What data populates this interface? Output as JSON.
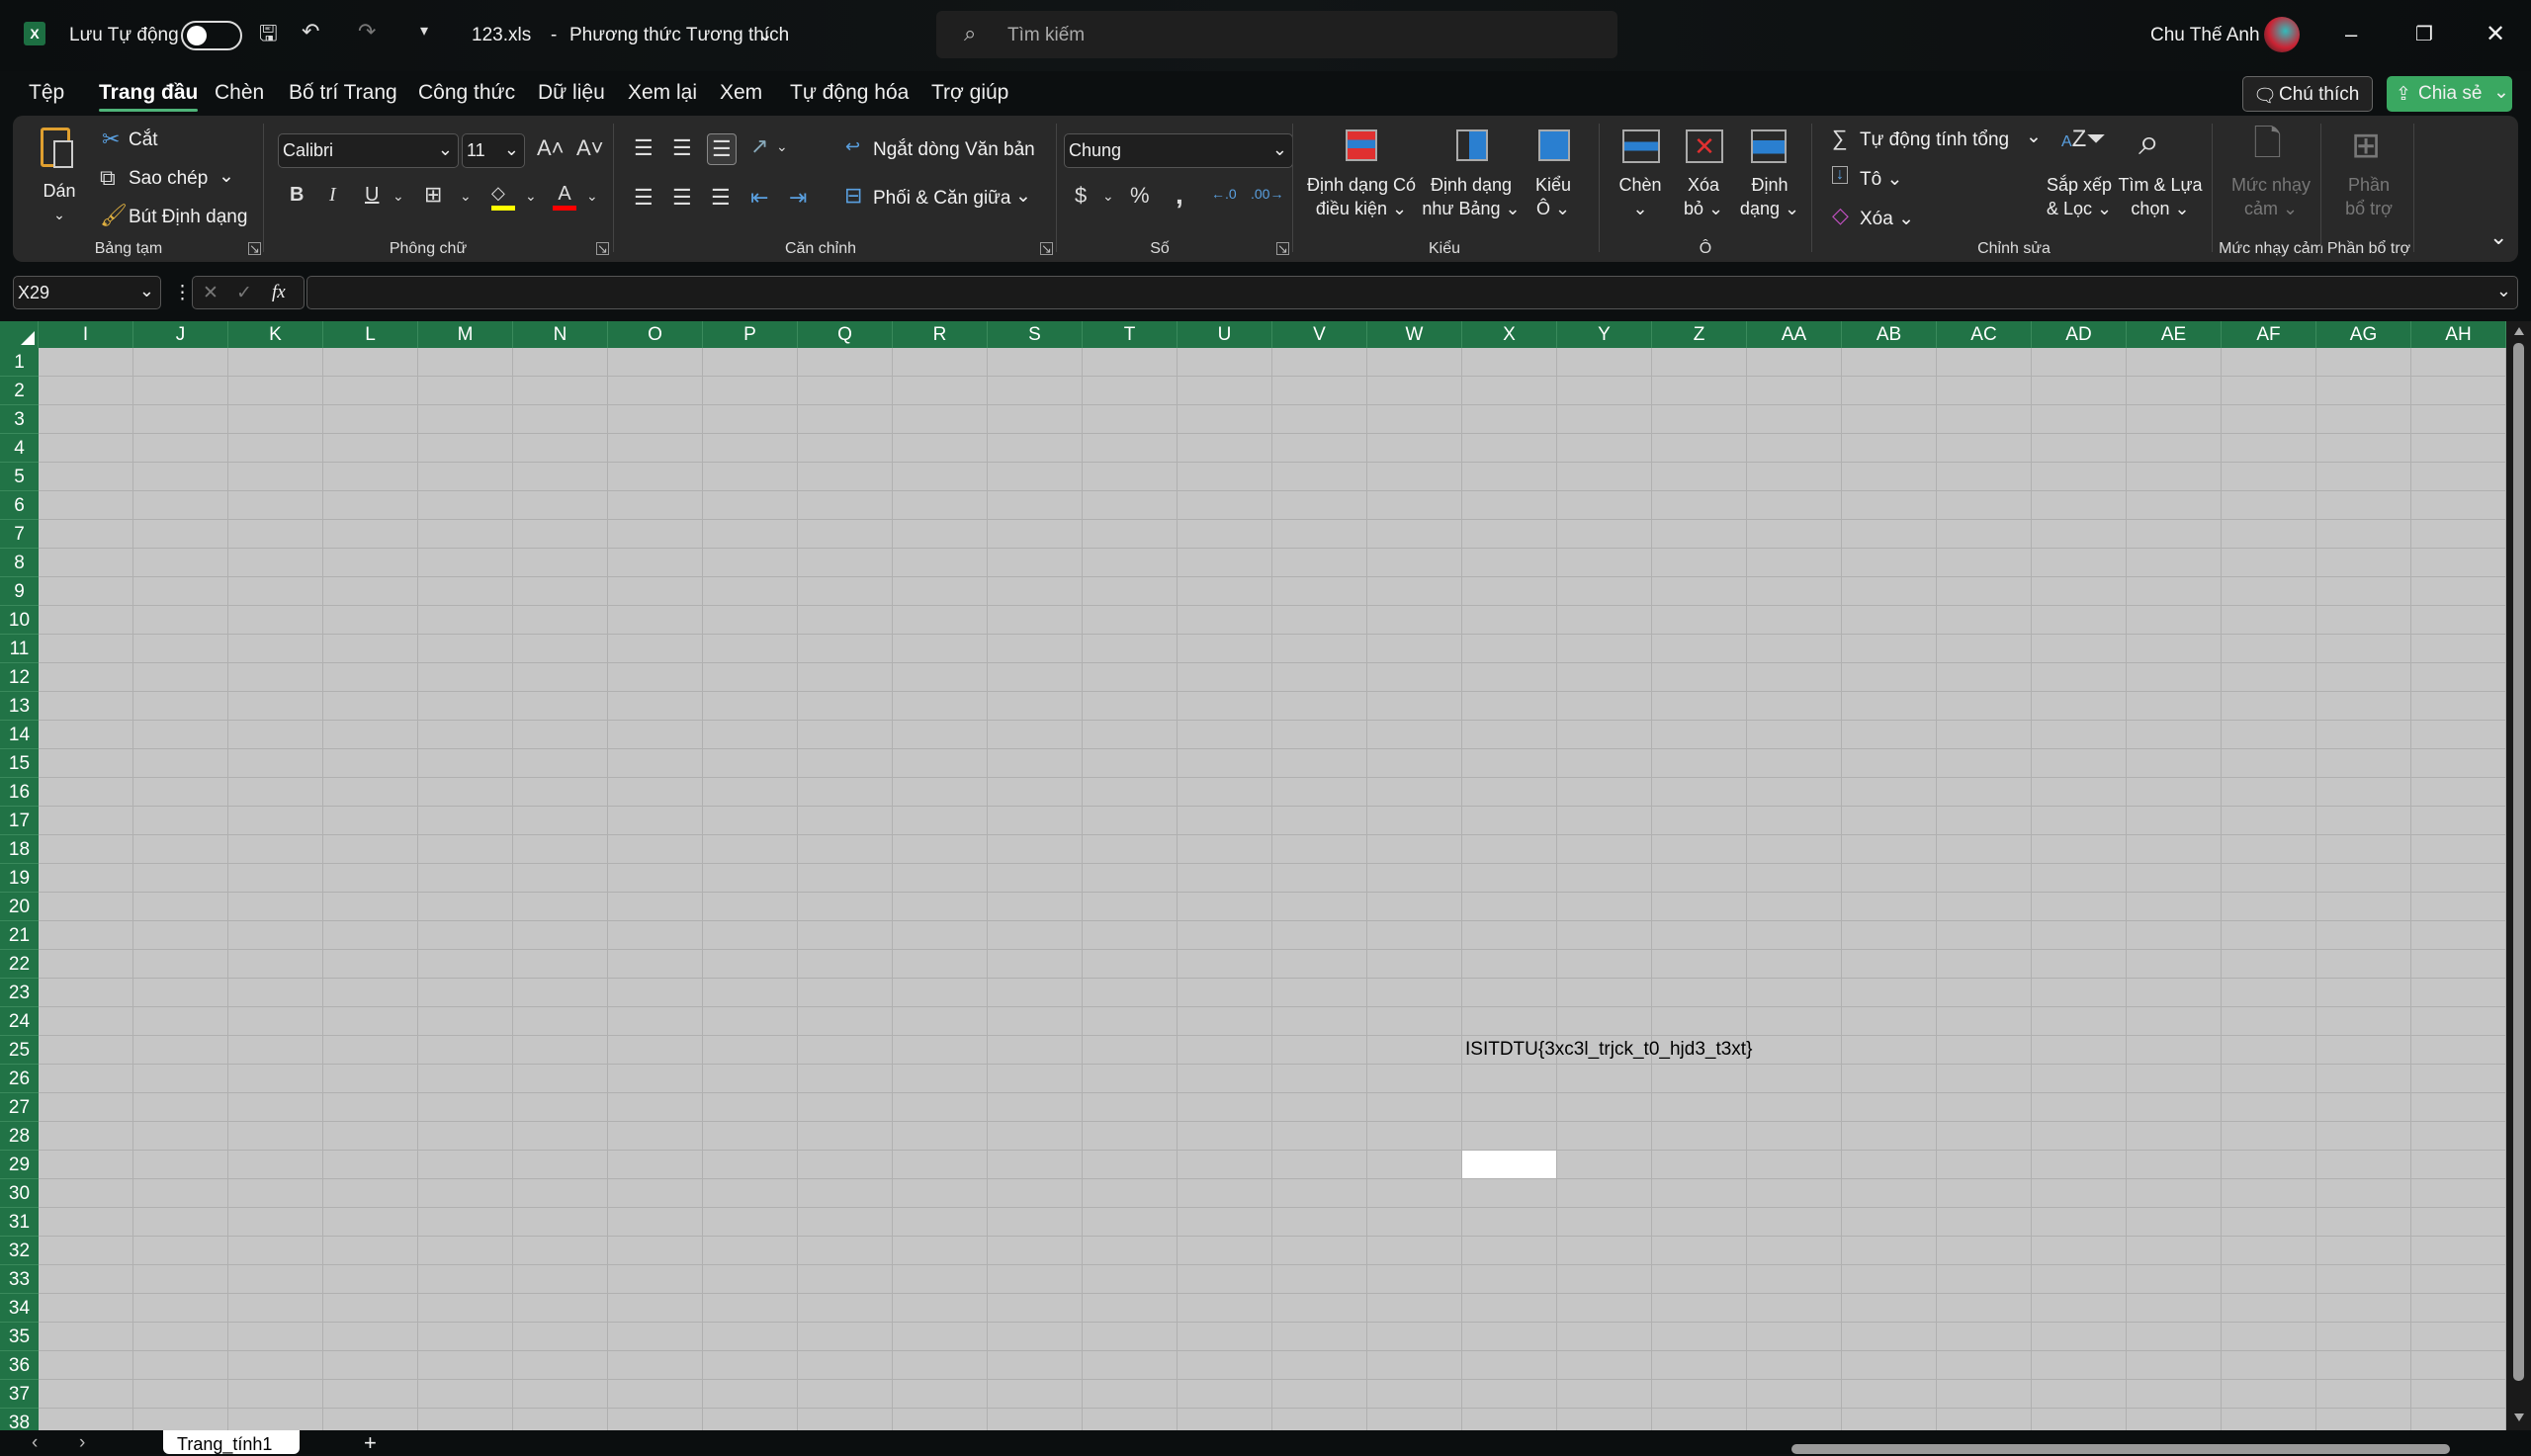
{
  "titlebar": {
    "autosave_label": "Lưu Tự động",
    "autosave_on": false,
    "filename": "123.xls",
    "mode": "Phương thức Tương thích",
    "search_placeholder": "Tìm kiếm",
    "user": "Chu Thế Anh",
    "colors": {
      "brand": "#217346",
      "accent": "#4fb479"
    }
  },
  "menu": {
    "tabs": [
      "Tệp",
      "Trang đầu",
      "Chèn",
      "Bố trí Trang",
      "Công thức",
      "Dữ liệu",
      "Xem lại",
      "Xem",
      "Tự động hóa",
      "Trợ giúp"
    ],
    "active": "Trang đầu",
    "comment": "Chú thích",
    "share": "Chia sẻ"
  },
  "ribbon": {
    "clipboard": {
      "label": "Bảng tạm",
      "paste": "Dán",
      "cut": "Cắt",
      "copy": "Sao chép",
      "painter": "Bút Định dạng"
    },
    "font": {
      "label": "Phông chữ",
      "name": "Calibri",
      "size": "11",
      "bold": "B",
      "italic": "I",
      "underline": "U"
    },
    "alignment": {
      "label": "Căn chỉnh",
      "wrap": "Ngắt dòng Văn bản",
      "merge": "Phối & Căn giữa"
    },
    "number": {
      "label": "Số",
      "format": "Chung"
    },
    "styles": {
      "label": "Kiểu",
      "cond1": "Định dạng Có",
      "cond2": "điều kiện",
      "table1": "Định dạng",
      "table2": "như Bảng",
      "cell1": "Kiểu",
      "cell2": "Ô"
    },
    "cells": {
      "label": "Ô",
      "insert": "Chèn",
      "delete1": "Xóa",
      "delete2": "bỏ",
      "format1": "Định",
      "format2": "dạng"
    },
    "editing": {
      "label": "Chỉnh sửa",
      "autosum": "Tự động tính tổng",
      "fill": "Tô",
      "clear": "Xóa",
      "sort1": "Sắp xếp",
      "sort2": "& Lọc",
      "find1": "Tìm & Lựa",
      "find2": "chọn"
    },
    "sensitivity": {
      "label": "Mức nhạy cảm",
      "b1": "Mức nhạy",
      "b2": "cảm"
    },
    "addins": {
      "label": "Phần bổ trợ",
      "b1": "Phần",
      "b2": "bổ trợ"
    }
  },
  "formula_bar": {
    "name_box": "X29",
    "fx": "fx",
    "value": ""
  },
  "sheet": {
    "columns": [
      "I",
      "J",
      "K",
      "L",
      "M",
      "N",
      "O",
      "P",
      "Q",
      "R",
      "S",
      "T",
      "U",
      "V",
      "W",
      "X",
      "Y",
      "Z",
      "AA",
      "AB",
      "AC",
      "AD",
      "AE",
      "AF",
      "AG",
      "AH"
    ],
    "first_row": 1,
    "last_row": 38,
    "cells": {
      "X25": "ISITDTU{3xc3l_trjck_t0_hjd3_t3xt}"
    },
    "selected": "X29"
  },
  "tabs": {
    "sheets": [
      "Trang_tính1"
    ],
    "active": "Trang_tính1"
  }
}
